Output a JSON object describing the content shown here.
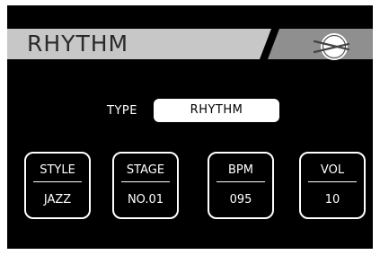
{
  "header": {
    "title": "RHYTHM",
    "icon": "drum-sticks-icon"
  },
  "type": {
    "label": "TYPE",
    "value": "RHYTHM"
  },
  "params": [
    {
      "label": "STYLE",
      "value": "JAZZ"
    },
    {
      "label": "STAGE",
      "value": "NO.01"
    },
    {
      "label": "BPM",
      "value": "095"
    },
    {
      "label": "VOL",
      "value": "10"
    }
  ],
  "colors": {
    "background": "#000000",
    "header_light": "#c7c7c7",
    "header_dark": "#8f8f8f",
    "text": "#ffffff"
  }
}
